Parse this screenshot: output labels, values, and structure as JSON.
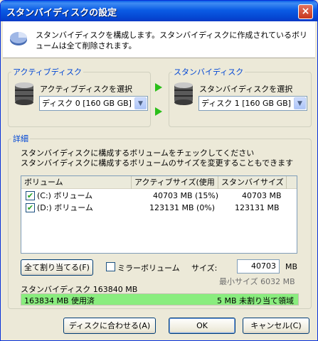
{
  "window": {
    "title": "スタンバイディスクの設定",
    "close": "×"
  },
  "header": {
    "description": "スタンバイディスクを構成します。スタンバイディスクに作成されているボリュームは全て削除されます。"
  },
  "active_disk": {
    "group_title": "アクティブディスク",
    "select_label": "アクティブディスクを選択",
    "selected": "ディスク 0 [160 GB GB] ("
  },
  "standby_disk": {
    "group_title": "スタンバイディスク",
    "select_label": "スタンバイディスクを選択",
    "selected": "ディスク 1 [160 GB GB]"
  },
  "details": {
    "group_title": "詳細",
    "instruction_1": "スタンバイディスクに構成するボリュームをチェックしてください",
    "instruction_2": "スタンバイディスクに構成するボリュームのサイズを変更することもできます",
    "columns": [
      "ボリューム",
      "アクティブサイズ(使用",
      "スタンバイサイズ"
    ],
    "rows": [
      {
        "checked": true,
        "volume": "(C:) ボリューム",
        "active_size": "40703 MB (15%)",
        "standby_size": "40703 MB"
      },
      {
        "checked": true,
        "volume": "(D:) ボリューム",
        "active_size": "123131 MB (0%)",
        "standby_size": "123131 MB"
      }
    ],
    "assign_all_button": "全て割り当てる(F)",
    "mirror_label": "ミラーボリューム",
    "mirror_checked": false,
    "size_label": "サイズ:",
    "size_value": "40703",
    "size_unit": "MB",
    "min_size_text": "最小サイズ 6032 MB",
    "standby_disk_size_text": "スタンバイディスク 163840 MB",
    "bar_used_text": "163834 MB  使用済",
    "bar_free_text": "5 MB 未割り当て領域",
    "bar_color": "#89ed7e"
  },
  "buttons": {
    "fit_to_disk": "ディスクに合わせる(A)",
    "ok": "OK",
    "cancel": "キャンセル(C)"
  }
}
